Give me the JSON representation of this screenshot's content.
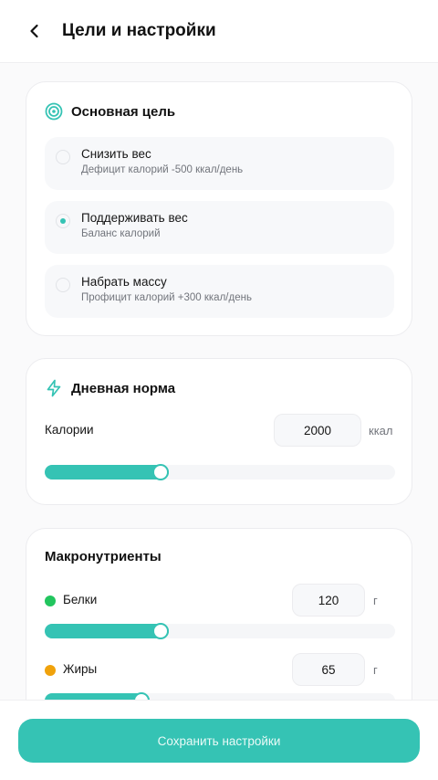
{
  "header": {
    "title": "Цели и настройки",
    "back_icon": "chevron-left-icon"
  },
  "goal": {
    "title": "Основная цель",
    "icon": "target-icon",
    "options": [
      {
        "title": "Снизить вес",
        "subtitle": "Дефицит калорий -500 ккал/день",
        "selected": false
      },
      {
        "title": "Поддерживать вес",
        "subtitle": "Баланс калорий",
        "selected": true
      },
      {
        "title": "Набрать массу",
        "subtitle": "Профицит калорий +300 ккал/день",
        "selected": false
      }
    ]
  },
  "daily": {
    "title": "Дневная норма",
    "icon": "lightning-icon",
    "calories_label": "Калории",
    "calories_value": "2000",
    "calories_unit": "ккал",
    "calories_slider_fraction": 0.355
  },
  "macros": {
    "title": "Макронутриенты",
    "items": [
      {
        "name": "Белки",
        "value": "120",
        "unit": "г",
        "color": "#22c55e",
        "slider_fraction": 0.355
      },
      {
        "name": "Жиры",
        "value": "65",
        "unit": "г",
        "color": "#f0a20b",
        "slider_fraction": 0.3
      }
    ]
  },
  "footer": {
    "save_label": "Сохранить настройки"
  },
  "colors": {
    "accent": "#35c3b4"
  }
}
